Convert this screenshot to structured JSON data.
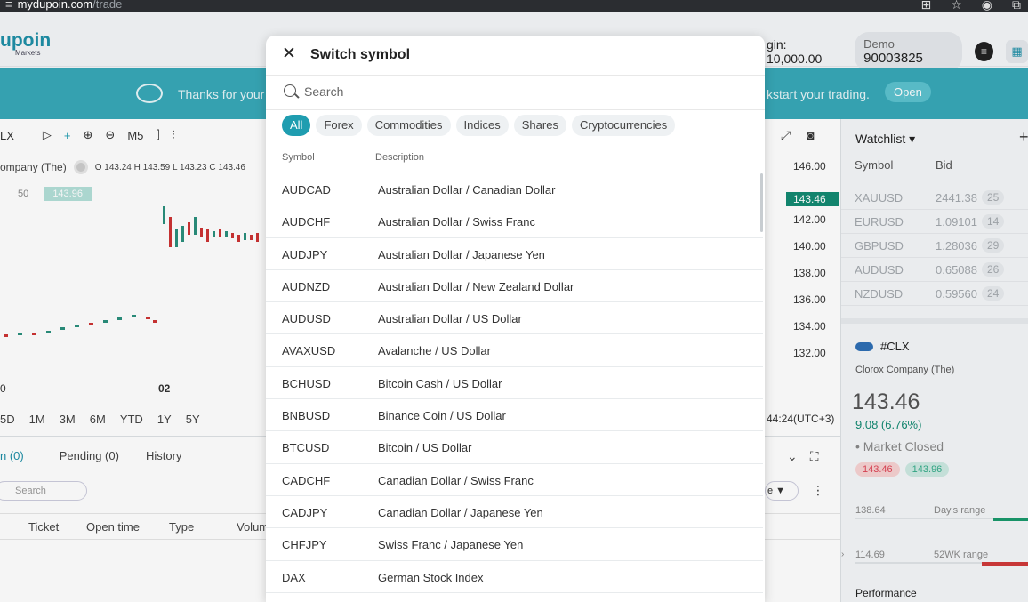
{
  "browser": {
    "host": "mydupoin.com",
    "path": "/trade"
  },
  "header": {
    "logo": "upoin",
    "logo_sub": "Markets",
    "margin_text": "gin: 10,000.00",
    "demo_label": "Demo",
    "demo_account": "90003825"
  },
  "banner": {
    "message_left": "Thanks for your",
    "message_right": "kstart your trading.",
    "open_label": "Open"
  },
  "chart": {
    "symbol_short": "LX",
    "timeframe": "M5",
    "symbol_line": "ompany (The)",
    "ohlc": "O 143.24  H 143.59  L 143.23  C 143.46",
    "ask_partial": "50",
    "bid_tag": "143.96",
    "current_price": "143.46",
    "axis_labels": [
      "146.00",
      "142.00",
      "140.00",
      "138.00",
      "136.00",
      "134.00",
      "132.00"
    ],
    "x_label_left": "0",
    "x_label": "02",
    "ranges": [
      "5D",
      "1M",
      "3M",
      "6M",
      "YTD",
      "1Y",
      "5Y"
    ],
    "utc": "44:24(UTC+3)"
  },
  "bottom": {
    "tabs": [
      "n (0)",
      "Pending (0)",
      "History"
    ],
    "search_placeholder": "Search",
    "filter_label": "e ▼",
    "columns": [
      "Ticket",
      "Open time",
      "Type",
      "Volum"
    ]
  },
  "watchlist": {
    "title": "Watchlist ▾",
    "col_symbol": "Symbol",
    "col_bid": "Bid",
    "rows": [
      {
        "symbol": "XAUUSD",
        "bid": "2441.38",
        "spread": "25"
      },
      {
        "symbol": "EURUSD",
        "bid": "1.09101",
        "spread": "14"
      },
      {
        "symbol": "GBPUSD",
        "bid": "1.28036",
        "spread": "29"
      },
      {
        "symbol": "AUDUSD",
        "bid": "0.65088",
        "spread": "26"
      },
      {
        "symbol": "NZDUSD",
        "bid": "0.59560",
        "spread": "24"
      }
    ]
  },
  "symbol_card": {
    "symbol": "#CLX",
    "name": "Clorox Company (The)",
    "price": "143.46",
    "change": "9.08 (6.76%)",
    "status": "• Market Closed",
    "bid": "143.46",
    "ask": "143.96",
    "day_low": "138.64",
    "day_label": "Day's range",
    "wk_low": "114.69",
    "wk_label": "52WK range",
    "performance": "Performance"
  },
  "modal": {
    "title": "Switch symbol",
    "search_placeholder": "Search",
    "filters": [
      "All",
      "Forex",
      "Commodities",
      "Indices",
      "Shares",
      "Cryptocurrencies"
    ],
    "col_symbol": "Symbol",
    "col_description": "Description",
    "rows": [
      {
        "symbol": "AUDCAD",
        "description": "Australian Dollar / Canadian Dollar"
      },
      {
        "symbol": "AUDCHF",
        "description": "Australian Dollar / Swiss Franc"
      },
      {
        "symbol": "AUDJPY",
        "description": "Australian Dollar / Japanese Yen"
      },
      {
        "symbol": "AUDNZD",
        "description": "Australian Dollar / New Zealand Dollar"
      },
      {
        "symbol": "AUDUSD",
        "description": "Australian Dollar / US Dollar"
      },
      {
        "symbol": "AVAXUSD",
        "description": "Avalanche / US Dollar"
      },
      {
        "symbol": "BCHUSD",
        "description": "Bitcoin Cash / US Dollar"
      },
      {
        "symbol": "BNBUSD",
        "description": "Binance Coin / US Dollar"
      },
      {
        "symbol": "BTCUSD",
        "description": "Bitcoin / US Dollar"
      },
      {
        "symbol": "CADCHF",
        "description": "Canadian Dollar / Swiss Franc"
      },
      {
        "symbol": "CADJPY",
        "description": "Canadian Dollar / Japanese Yen"
      },
      {
        "symbol": "CHFJPY",
        "description": "Swiss Franc / Japanese Yen"
      },
      {
        "symbol": "DAX",
        "description": "German Stock Index"
      }
    ]
  },
  "colors": {
    "accent": "#1f9db0",
    "banner": "#38a8b8",
    "up": "#138a72",
    "down": "#d03a3a"
  }
}
